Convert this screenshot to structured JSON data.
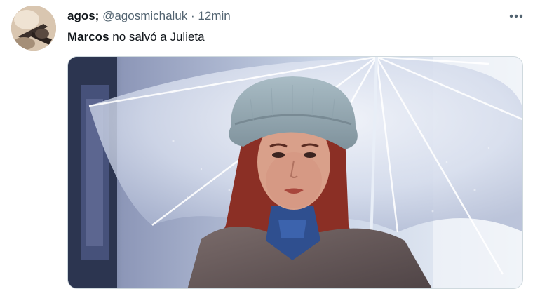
{
  "tweet": {
    "display_name": "agos;",
    "handle": "@agosmichaluk",
    "separator": "·",
    "time": "12min",
    "text_mention": "Marcos",
    "text_body": " no salvó a Julieta"
  },
  "icons": {
    "avatar": "profile-avatar",
    "more": "more-dots-icon"
  },
  "colors": {
    "name": "#0f1419",
    "meta": "#536471",
    "border": "#cfd9de"
  }
}
